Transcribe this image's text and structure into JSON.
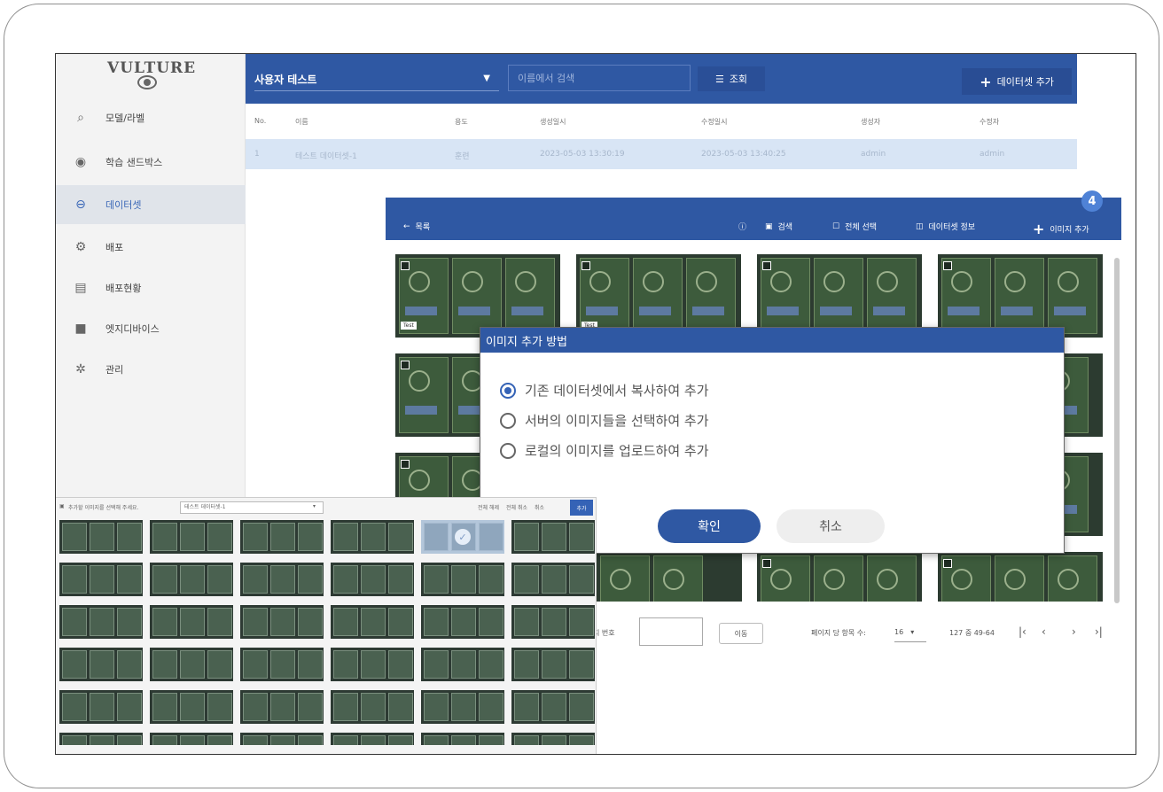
{
  "sidebar": {
    "logo_text": "VULTURE",
    "items": [
      {
        "label": "모델/라벨",
        "icon": "model-label-icon"
      },
      {
        "label": "학습 샌드박스",
        "icon": "sandbox-icon"
      },
      {
        "label": "데이터셋",
        "icon": "dataset-icon",
        "active": true
      },
      {
        "label": "배포",
        "icon": "deploy-icon"
      },
      {
        "label": "배포현황",
        "icon": "deploy-status-icon"
      },
      {
        "label": "엣지디바이스",
        "icon": "edge-device-icon"
      },
      {
        "label": "관리",
        "icon": "settings-gear-icon"
      }
    ]
  },
  "topbar": {
    "project": "사용자 테스트",
    "search_placeholder": "이름에서 검색",
    "query_label": "조회",
    "add_dataset_label": "데이터셋 추가"
  },
  "table": {
    "headers": [
      "No.",
      "이름",
      "용도",
      "생성일시",
      "수정일시",
      "생성자",
      "수정자"
    ],
    "rows": [
      [
        "1",
        "테스트 데이터셋-1",
        "훈련",
        "2023-05-03 13:30:19",
        "2023-05-03 13:40:25",
        "admin",
        "admin"
      ]
    ]
  },
  "panel": {
    "back_label": "목록",
    "search_label": "검색",
    "select_all_label": "전체 선택",
    "info_label": "데이터셋 정보",
    "add_image_label": "이미지 추가",
    "step_badge": "4",
    "tile_tags": [
      "Test",
      "Test"
    ]
  },
  "dialog": {
    "title": "이미지 추가 방법",
    "options": [
      {
        "label": "기존 데이터셋에서 복사하여 추가",
        "selected": true
      },
      {
        "label": "서버의 이미지들을 선택하여 추가",
        "selected": false
      },
      {
        "label": "로컬의 이미지를 업로드하여 추가",
        "selected": false
      }
    ],
    "confirm_label": "확인",
    "cancel_label": "취소"
  },
  "pager": {
    "page_label": "지 번호",
    "go_label": "이동",
    "per_page_label": "페이지 당 항목 수:",
    "per_page_value": "16",
    "range_text": "127 중 49-64"
  },
  "picker": {
    "prompt": "추가할 이미지를 선택해 주세요.",
    "dataset_value": "테스트 데이터셋-1",
    "select_all_label": "전체 해제",
    "page_select_label": "전체 취소",
    "cancel_label": "취소",
    "add_label": "추가"
  }
}
